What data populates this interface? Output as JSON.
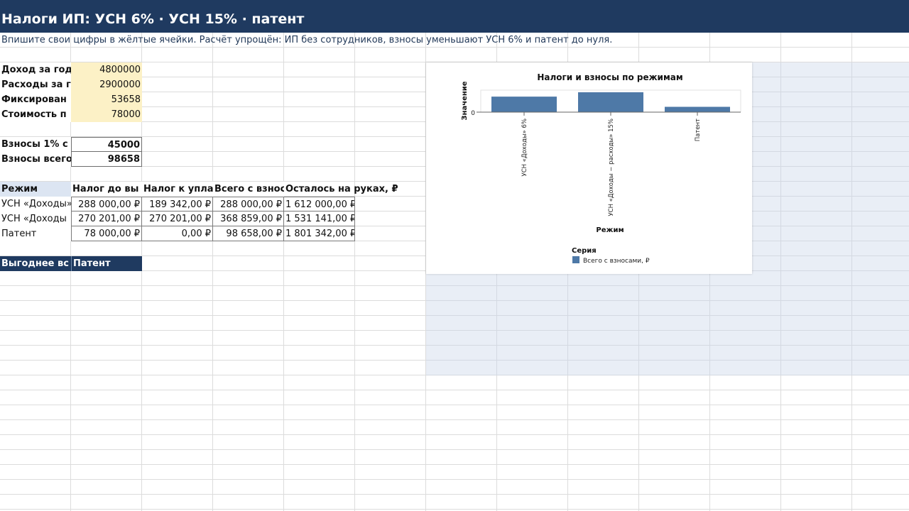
{
  "header": {
    "title": "Налоги ИП: УСН 6% · УСН 15% · патент",
    "subtitle": "Впишите свои цифры в жёлтые ячейки. Расчёт упрощён: ИП без сотрудников, взносы уменьшают УСН 6% и патент до нуля."
  },
  "inputs": [
    {
      "label": "Доход за год,",
      "value": "4800000"
    },
    {
      "label": "Расходы за г",
      "value": "2900000"
    },
    {
      "label": "Фиксирован",
      "value": "53658"
    },
    {
      "label": "Стоимость п",
      "value": "78000"
    }
  ],
  "contributions": [
    {
      "label": "Взносы 1% с",
      "value": "45000"
    },
    {
      "label": "Взносы всего",
      "value": "98658"
    }
  ],
  "table": {
    "headers": [
      "Режим",
      "Налог до вы",
      "Налог к упла",
      "Всего с взнос",
      "Осталось на руках, ₽"
    ],
    "rows": [
      [
        "УСН «Доходы»",
        "288 000,00 ₽",
        "189 342,00 ₽",
        "288 000,00 ₽",
        "1 612 000,00 ₽"
      ],
      [
        "УСН «Доходы",
        "270 201,00 ₽",
        "270 201,00 ₽",
        "368 859,00 ₽",
        "1 531 141,00 ₽"
      ],
      [
        "Патент",
        "78 000,00 ₽",
        "0,00 ₽",
        "98 658,00 ₽",
        "1 801 342,00 ₽"
      ]
    ]
  },
  "best": {
    "label": "Выгоднее вс",
    "value": "Патент"
  },
  "chart_data": {
    "type": "bar",
    "title": "Налоги и взносы по режимам",
    "xlabel": "Режим",
    "ylabel": "Значение",
    "categories": [
      "УСН «Доходы» 6%",
      "УСН «Доходы − расходы» 15%",
      "Патент"
    ],
    "series": [
      {
        "name": "Всего с взносами, ₽",
        "values": [
          288000,
          368859,
          98658
        ],
        "color": "#4e79a7"
      }
    ],
    "ylim": [
      0,
      368859
    ],
    "y_ticks": [
      "0"
    ],
    "legend_title": "Серия",
    "legend": "bottom-left",
    "grid": false
  }
}
